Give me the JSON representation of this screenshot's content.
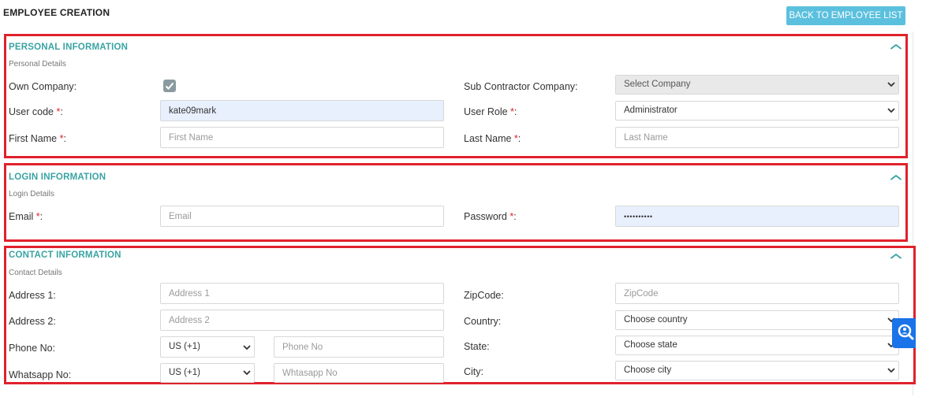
{
  "header": {
    "title": "EMPLOYEE CREATION",
    "back_label": "BACK TO EMPLOYEE LIST"
  },
  "personal": {
    "title": "PERSONAL INFORMATION",
    "subtitle": "Personal Details",
    "own_company_label": "Own Company:",
    "own_company_checked": true,
    "sub_contractor_label": "Sub Contractor Company:",
    "sub_contractor_value": "Select Company",
    "user_code_label": "User code ",
    "user_code_value": "kate09mark",
    "user_role_label": "User Role ",
    "user_role_value": "Administrator",
    "first_name_label": "First Name ",
    "first_name_placeholder": "First Name",
    "last_name_label": "Last Name ",
    "last_name_placeholder": "Last Name",
    "required_mark": "*",
    "label_suffix": ":"
  },
  "login": {
    "title": "LOGIN INFORMATION",
    "subtitle": "Login Details",
    "email_label": "Email ",
    "email_placeholder": "Email",
    "password_label": "Password ",
    "password_value": "••••••••••"
  },
  "contact": {
    "title": "CONTACT INFORMATION",
    "subtitle": "Contact Details",
    "address1_label": "Address 1:",
    "address1_placeholder": "Address 1",
    "address2_label": "Address 2:",
    "address2_placeholder": "Address 2",
    "phone_label": "Phone No:",
    "phone_code": "US (+1)",
    "phone_placeholder": "Phone No",
    "whatsapp_label": "Whatsapp No:",
    "whatsapp_code": "US (+1)",
    "whatsapp_placeholder": "Whtasapp No",
    "zipcode_label": "ZipCode:",
    "zipcode_placeholder": "ZipCode",
    "country_label": "Country:",
    "country_value": "Choose country",
    "state_label": "State:",
    "state_value": "Choose state",
    "city_label": "City:",
    "city_value": "Choose city"
  },
  "colors": {
    "accent": "#3aa3a3",
    "highlight_border": "#e0212b",
    "button": "#5bc0de",
    "widget": "#1a73e8"
  },
  "icons": {
    "collapse": "chevron-up-icon",
    "select": "chevron-down-icon",
    "check": "check-icon",
    "help": "help-search-icon"
  }
}
